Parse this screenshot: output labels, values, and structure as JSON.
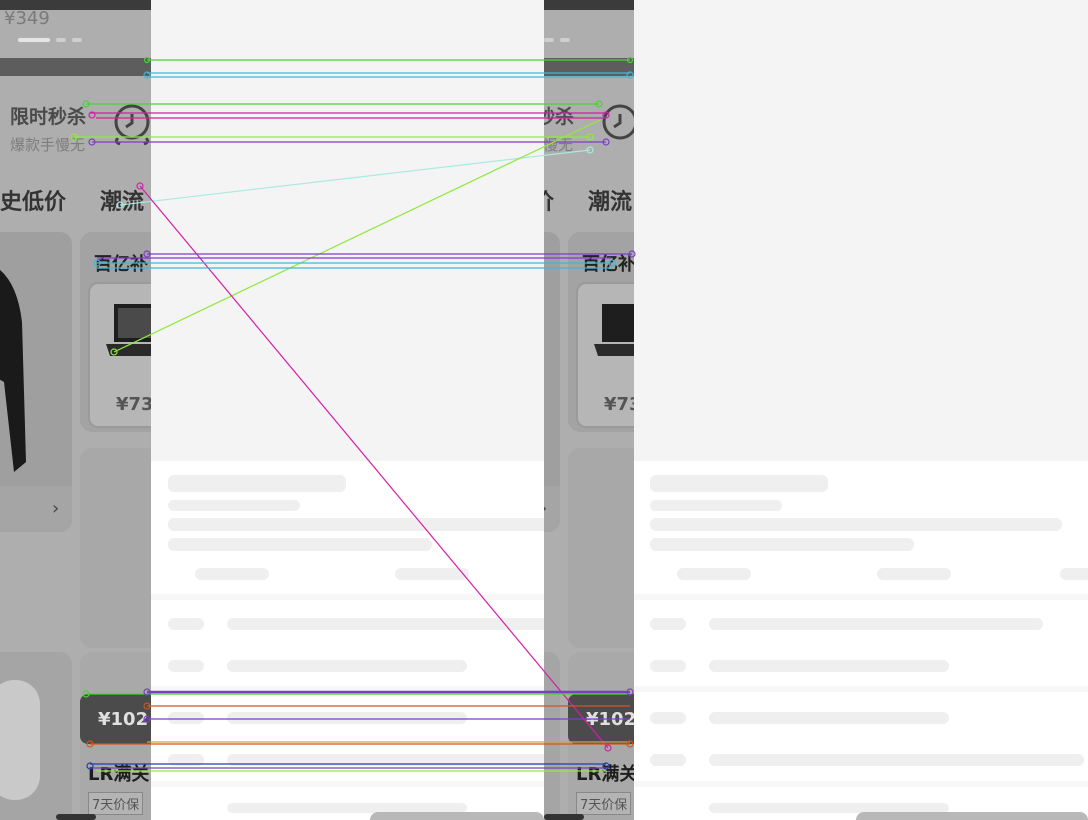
{
  "app": {
    "price_top": "¥349",
    "flash_sale_title": "限时秒杀",
    "flash_sale_subtitle": "爆款手慢无",
    "tab_lowest_price": "史低价",
    "tab_trend": "潮流",
    "subsidy_title": "百亿补",
    "laptop_price": "¥73",
    "pill_price": "¥102",
    "promo_text": "LR满关",
    "warranty_badge": "7天价保",
    "chevron_icon": "chevron-right-icon"
  },
  "colors": {
    "match_green": "#4cd137",
    "match_cyan": "#3fb8d6",
    "match_magenta": "#d020a8",
    "match_purple": "#7b3fc4",
    "match_light_green": "#8fea3c",
    "match_pale_cyan": "#a8eadf",
    "match_orange": "#d2551c"
  }
}
